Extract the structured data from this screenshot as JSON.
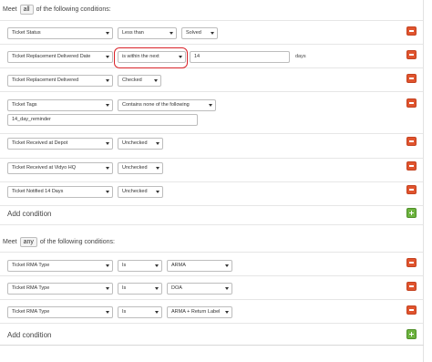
{
  "all_group": {
    "prefix": "Meet",
    "selector": "all",
    "suffix": "of the following conditions:",
    "conditions": [
      {
        "field": "Ticket Status",
        "operator": "Less than",
        "value": "Solved"
      },
      {
        "field": "Ticket Replacement Delivered Date",
        "operator": "is within the next",
        "value": "14",
        "unit": "days"
      },
      {
        "field": "Ticket Replacement Delivered",
        "operator": "Checked"
      },
      {
        "field": "Ticket Tags",
        "operator": "Contains none of the following",
        "value": "14_day_reminder"
      },
      {
        "field": "Ticket Received at Depot",
        "operator": "Unchecked"
      },
      {
        "field": "Ticket Received at Vidyo HQ",
        "operator": "Unchecked"
      },
      {
        "field": "Ticket Notified 14 Days",
        "operator": "Unchecked"
      }
    ],
    "add_label": "Add condition"
  },
  "any_group": {
    "prefix": "Meet",
    "selector": "any",
    "suffix": "of the following conditions:",
    "conditions": [
      {
        "field": "Ticket RMA Type",
        "operator": "Is",
        "value": "ARMA"
      },
      {
        "field": "Ticket RMA Type",
        "operator": "Is",
        "value": "DOA"
      },
      {
        "field": "Ticket RMA Type",
        "operator": "Is",
        "value": "ARMA + Return Label"
      }
    ],
    "add_label": "Add condition"
  },
  "colors": {
    "remove": "#e0542e",
    "add": "#6db33f",
    "highlight": "#d9232a"
  }
}
